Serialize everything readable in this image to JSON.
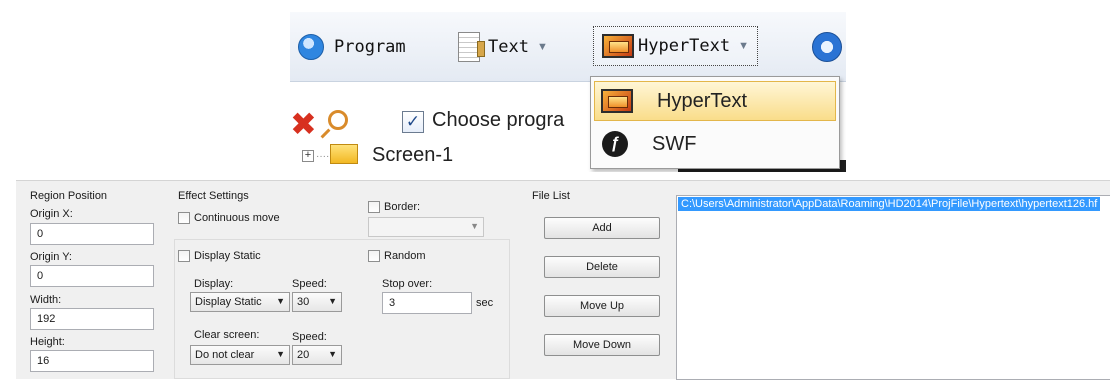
{
  "toolbar": {
    "program_label": "Program",
    "text_label": "Text",
    "hypertext_label": "HyperText",
    "choose_label": "Choose progra",
    "screen_label": "Screen-1"
  },
  "dropdown": {
    "items": [
      {
        "label": "HyperText",
        "icon": "hypertext-image-icon",
        "selected": true
      },
      {
        "label": "SWF",
        "icon": "swf-flash-icon",
        "selected": false
      }
    ]
  },
  "region_position": {
    "title": "Region Position",
    "origin_x_label": "Origin X:",
    "origin_x": "0",
    "origin_y_label": "Origin Y:",
    "origin_y": "0",
    "width_label": "Width:",
    "width": "192",
    "height_label": "Height:",
    "height": "16"
  },
  "effect_settings": {
    "title": "Effect Settings",
    "continuous_move": "Continuous move",
    "border_label": "Border:",
    "display_static": "Display Static",
    "random": "Random",
    "display_label": "Display:",
    "display_value": "Display Static",
    "speed_label": "Speed:",
    "speed_value": "30",
    "stop_over_label": "Stop over:",
    "stop_over_value": "3",
    "stop_over_unit": "sec",
    "clear_screen_label": "Clear screen:",
    "clear_screen_value": "Do not clear",
    "speed2_label": "Speed:",
    "speed2_value": "20"
  },
  "file_list": {
    "title": "File List",
    "add": "Add",
    "delete": "Delete",
    "move_up": "Move Up",
    "move_down": "Move Down",
    "files": [
      "C:\\Users\\Administrator\\AppData\\Roaming\\HD2014\\ProjFile\\Hypertext\\hypertext126.hf"
    ]
  },
  "colors": {
    "selection": "#3399ff",
    "menu_highlight": "#f9dd8a",
    "delete_red": "#d7301f"
  }
}
